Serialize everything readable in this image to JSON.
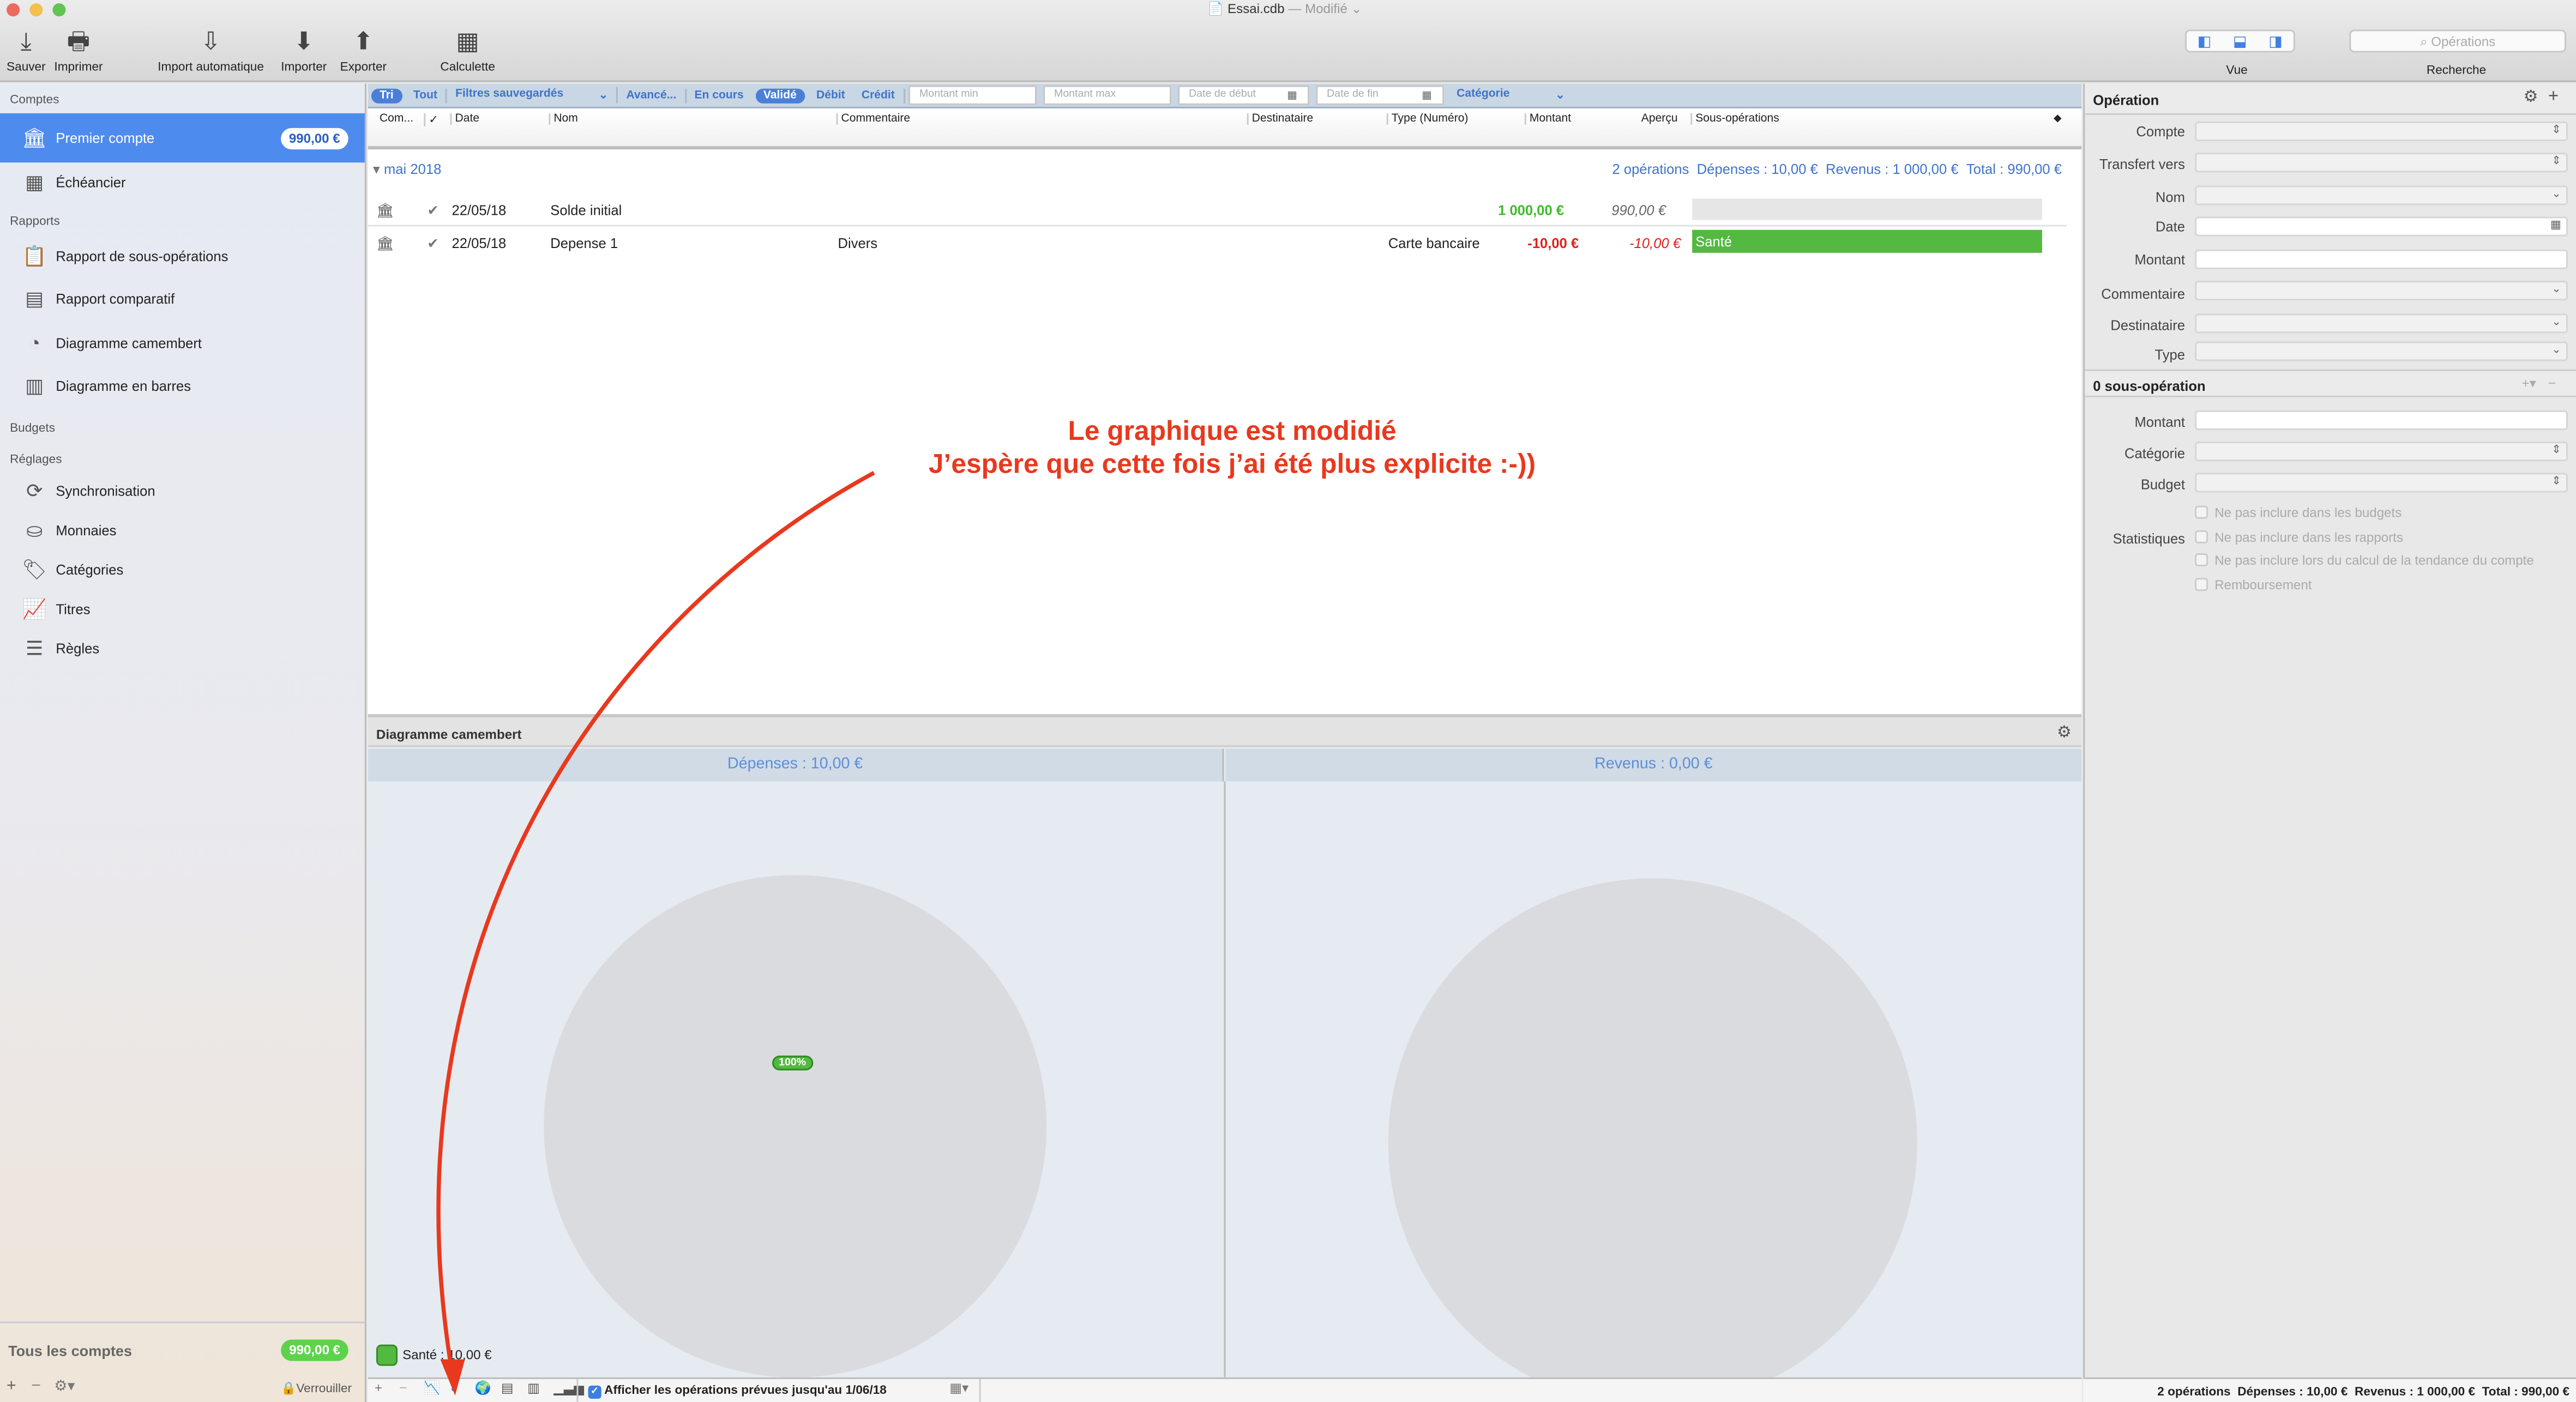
{
  "window": {
    "title": "Essai.cdb",
    "status": "— Modifié"
  },
  "toolbar": {
    "save": "Sauver",
    "print": "Imprimer",
    "auto_import": "Import automatique",
    "import": "Importer",
    "export": "Exporter",
    "calculator": "Calculette",
    "view": "Vue",
    "search_label": "Recherche",
    "search_placeholder": "Opérations"
  },
  "sidebar": {
    "accounts_header": "Comptes",
    "account": {
      "label": "Premier compte",
      "balance": "990,00 €"
    },
    "scheduler": "Échéancier",
    "reports_header": "Rapports",
    "reports": [
      "Rapport de sous-opérations",
      "Rapport comparatif",
      "Diagramme camembert",
      "Diagramme en barres"
    ],
    "budgets_header": "Budgets",
    "settings_header": "Réglages",
    "settings": [
      "Synchronisation",
      "Monnaies",
      "Catégories",
      "Titres",
      "Règles"
    ],
    "all_accounts": {
      "label": "Tous les comptes",
      "balance": "990,00 €"
    },
    "lock": "Verrouiller"
  },
  "filters": {
    "sort": "Tri",
    "all": "Tout",
    "saved": "Filtres sauvegardés",
    "advanced": "Avancé...",
    "pending": "En cours",
    "validated": "Validé",
    "debit": "Débit",
    "credit": "Crédit",
    "min_placeholder": "Montant min",
    "max_placeholder": "Montant max",
    "start_placeholder": "Date de début",
    "end_placeholder": "Date de fin",
    "category": "Catégorie"
  },
  "columns": [
    "Com...",
    "✓",
    "Date",
    "Nom",
    "Commentaire",
    "Destinataire",
    "Type (Numéro)",
    "Montant",
    "Aperçu",
    "Sous-opérations"
  ],
  "group": {
    "label": "mai 2018",
    "count": "2 opérations",
    "expenses": "Dépenses : 10,00 €",
    "income": "Revenus : 1 000,00 €",
    "total": "Total : 990,00 €"
  },
  "rows": [
    {
      "date": "22/05/18",
      "name": "Solde initial",
      "comment": "",
      "payee": "",
      "type": "",
      "amount": "1 000,00 €",
      "preview": "990,00 €",
      "split": ""
    },
    {
      "date": "22/05/18",
      "name": "Depense 1",
      "comment": "Divers",
      "payee": "",
      "type": "Carte bancaire",
      "amount": "-10,00 €",
      "preview": "-10,00 €",
      "split": "Santé"
    }
  ],
  "annotation": {
    "line1": "Le graphique est modidié",
    "line2": "J’espère que cette fois j’ai été plus explicite :-))",
    "color": "#e8391e"
  },
  "chart_panel": {
    "title": "Diagramme camembert"
  },
  "chart_data": [
    {
      "type": "pie",
      "title": "Dépenses : 10,00 €",
      "slices": [
        {
          "name": "Santé",
          "value": 10.0,
          "percent": 100,
          "color": "#53b940"
        }
      ],
      "data_label": "100%",
      "legend": [
        {
          "label": "Santé : 10,00 €"
        }
      ]
    },
    {
      "type": "pie",
      "title": "Revenus : 0,00 €",
      "slices": []
    }
  ],
  "bottom": {
    "show_planned": "Afficher les opérations prévues jusqu'au 1/06/18",
    "summary": {
      "count": "2 opérations",
      "expenses": "Dépenses : 10,00 €",
      "income": "Revenus : 1 000,00 €",
      "total": "Total : 990,00 €"
    }
  },
  "inspector": {
    "title": "Opération",
    "fields": [
      "Compte",
      "Transfert vers",
      "Nom",
      "Date",
      "Montant",
      "Commentaire",
      "Destinataire",
      "Type"
    ],
    "split_title": "0 sous-opération",
    "split_fields": [
      "Montant",
      "Catégorie",
      "Budget"
    ],
    "stats_label": "Statistiques",
    "checks": [
      "Ne pas inclure dans les budgets",
      "Ne pas inclure dans les rapports",
      "Ne pas inclure lors du calcul de la tendance du compte",
      "Remboursement"
    ]
  },
  "colors": {
    "accent": "#4a89ee",
    "positive": "#3dbb2a",
    "negative": "#e0201a",
    "category": "#53b940"
  }
}
